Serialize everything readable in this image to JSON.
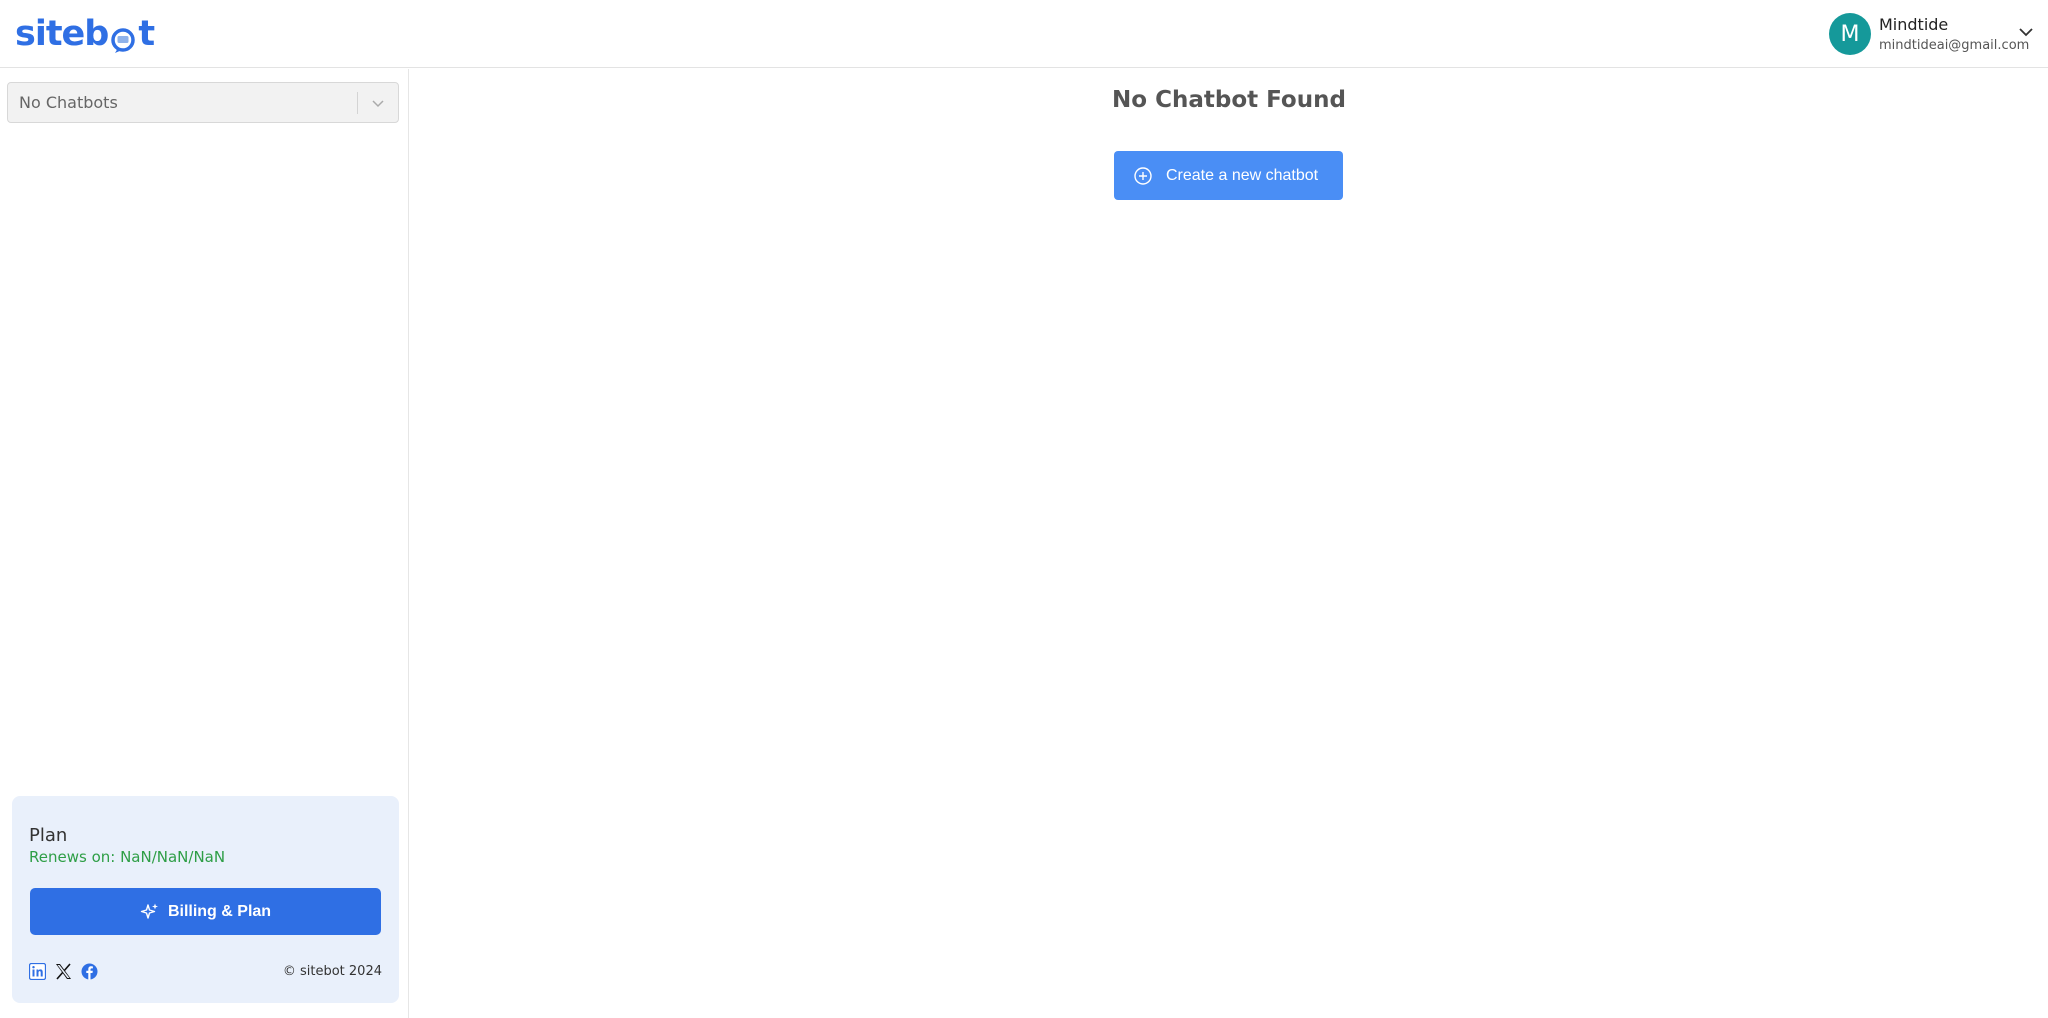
{
  "brand": {
    "logo_text_a": "siteb",
    "logo_text_b": "t"
  },
  "user": {
    "initial": "M",
    "name": "Mindtide",
    "email": "mindtideai@gmail.com"
  },
  "sidebar": {
    "chatbot_select": {
      "selected": "No Chatbots"
    },
    "plan": {
      "title": "Plan",
      "renews": "Renews on: NaN/NaN/NaN",
      "billing_label": "Billing & Plan"
    },
    "socials": [
      "linkedin-icon",
      "x-icon",
      "facebook-icon"
    ],
    "copyright": "© sitebot 2024"
  },
  "main": {
    "title": "No Chatbot Found",
    "create_label": "Create a new chatbot"
  },
  "colors": {
    "brand": "#2f6fe4",
    "create": "#4a8ef5",
    "avatar": "#15999a",
    "renew": "#2e9e46"
  }
}
